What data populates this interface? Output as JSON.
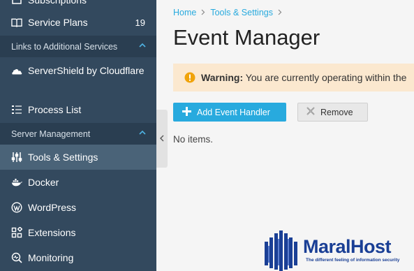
{
  "sidebar": {
    "items_top": [
      {
        "label": "Subscriptions",
        "icon": "subscriptions-icon"
      },
      {
        "label": "Service Plans",
        "icon": "book-icon",
        "count": "19"
      }
    ],
    "section1": {
      "label": "Links to Additional Services"
    },
    "section1_items": [
      {
        "label": "ServerShield by Cloudflare",
        "icon": "cloud-icon"
      },
      {
        "label": "Process List",
        "icon": "process-list-icon"
      }
    ],
    "section2": {
      "label": "Server Management"
    },
    "section2_items": [
      {
        "label": "Tools & Settings",
        "icon": "sliders-icon"
      },
      {
        "label": "Docker",
        "icon": "docker-icon"
      },
      {
        "label": "WordPress",
        "icon": "wordpress-icon"
      },
      {
        "label": "Extensions",
        "icon": "extensions-icon"
      },
      {
        "label": "Monitoring",
        "icon": "monitoring-icon"
      }
    ]
  },
  "breadcrumb": {
    "home": "Home",
    "tools": "Tools & Settings"
  },
  "page": {
    "title": "Event Manager"
  },
  "warning": {
    "label": "Warning:",
    "text": "You are currently operating within the"
  },
  "toolbar": {
    "add_label": "Add Event Handler",
    "remove_label": "Remove"
  },
  "list": {
    "empty_text": "No items."
  },
  "watermark": {
    "name": "MaralHost",
    "tagline": "The different feeling of information security"
  },
  "colors": {
    "sidebar": "#33495e",
    "section": "#2a3e51",
    "active": "#4a6378",
    "accent": "#28aade",
    "warning_bg": "#fbe8cf"
  }
}
